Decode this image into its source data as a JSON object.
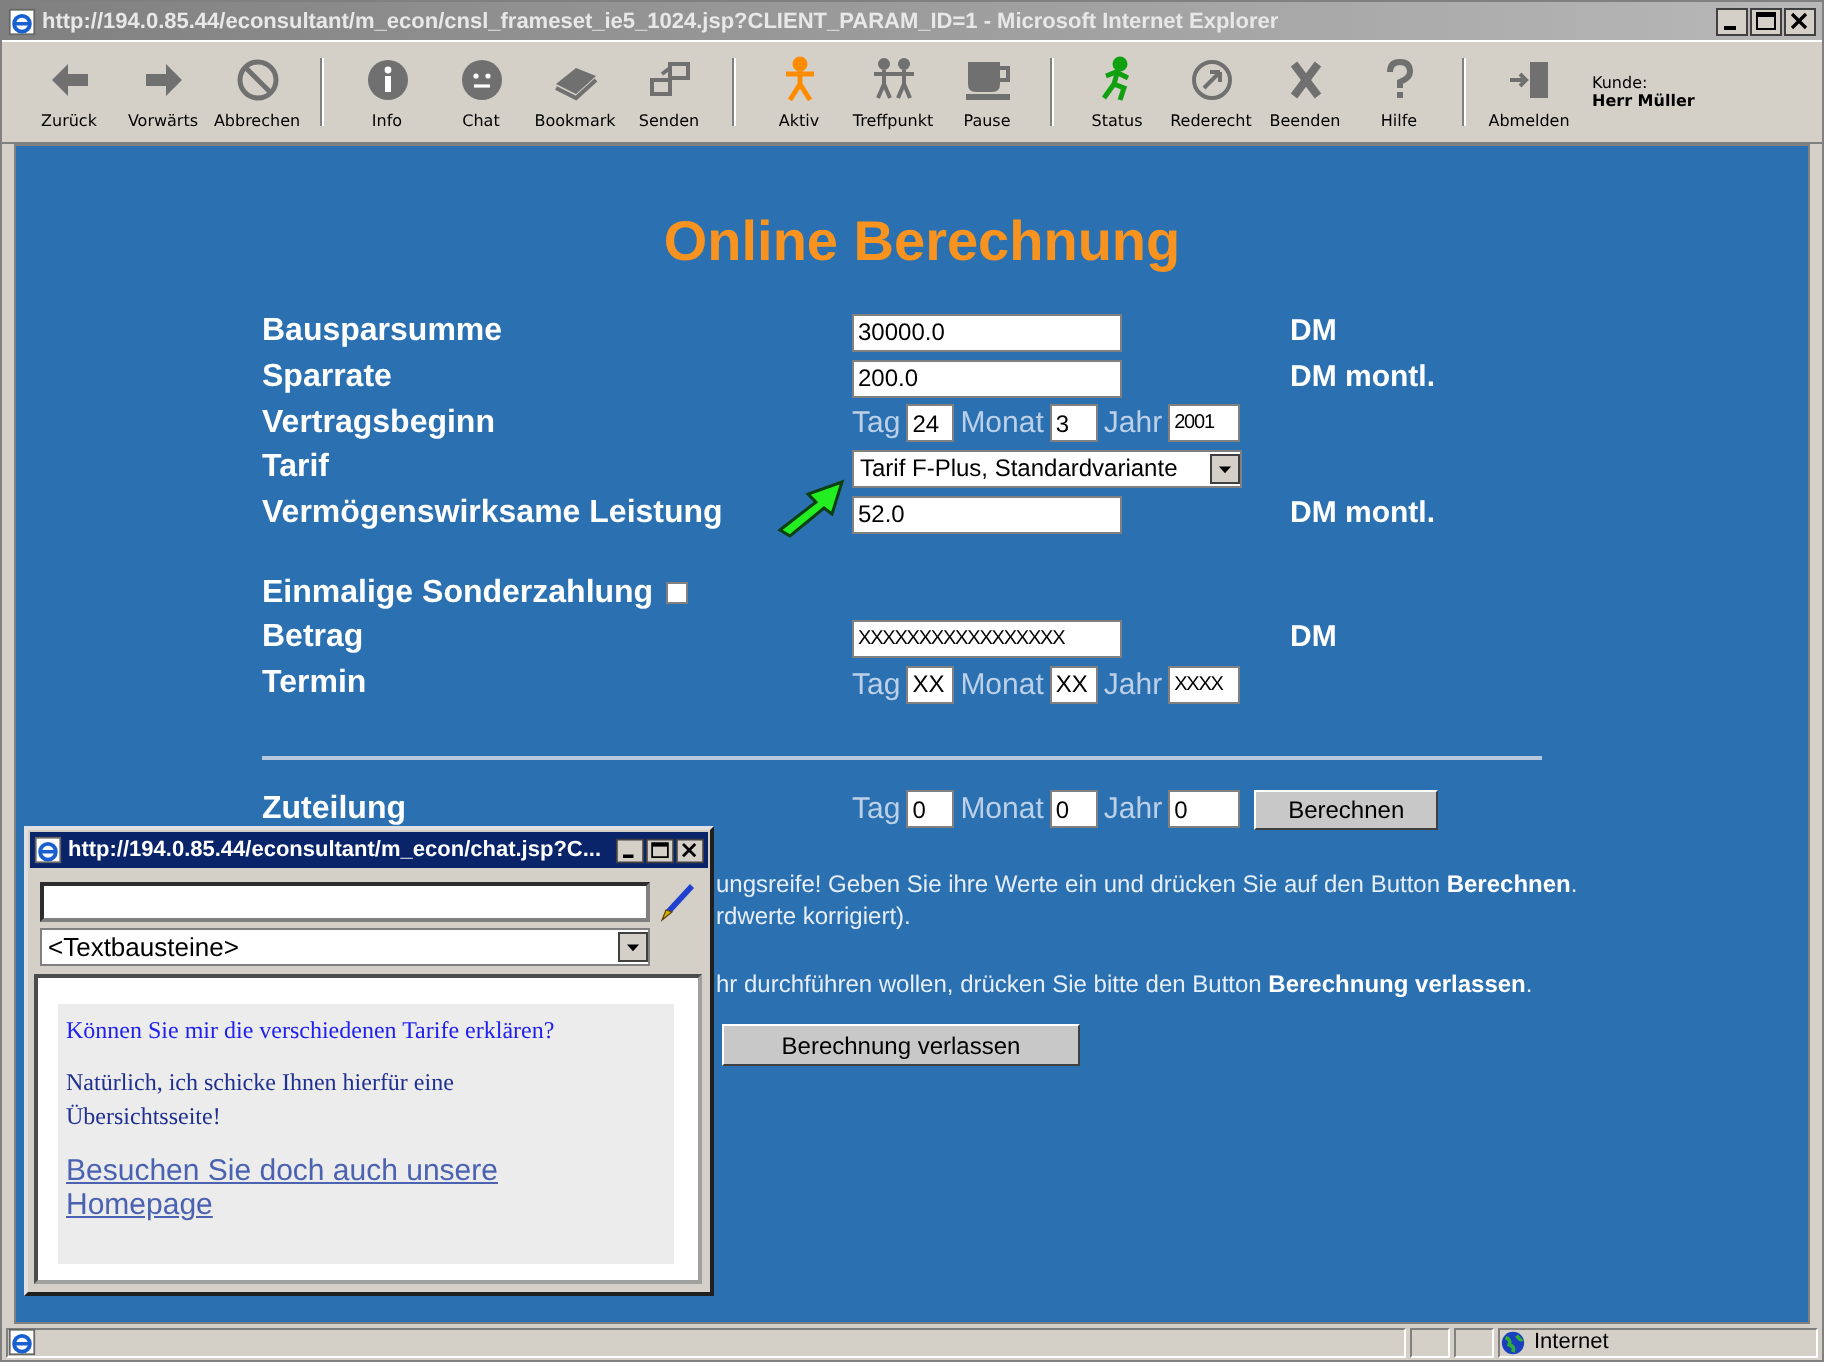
{
  "window": {
    "title": "http://194.0.85.44/econsultant/m_econ/cnsl_frameset_ie5_1024.jsp?CLIENT_PARAM_ID=1 - Microsoft Internet Explorer"
  },
  "toolbar": {
    "groups": [
      [
        {
          "kind": "back",
          "label": "Zurück"
        },
        {
          "kind": "forward",
          "label": "Vorwärts"
        },
        {
          "kind": "stop",
          "label": "Abbrechen"
        }
      ],
      [
        {
          "kind": "info",
          "label": "Info"
        },
        {
          "kind": "chat",
          "label": "Chat"
        },
        {
          "kind": "bookmark",
          "label": "Bookmark"
        },
        {
          "kind": "send",
          "label": "Senden"
        }
      ],
      [
        {
          "kind": "active",
          "label": "Aktiv"
        },
        {
          "kind": "meeting",
          "label": "Treffpunkt"
        },
        {
          "kind": "pause",
          "label": "Pause"
        }
      ],
      [
        {
          "kind": "status",
          "label": "Status"
        },
        {
          "kind": "floor",
          "label": "Rederecht"
        },
        {
          "kind": "end",
          "label": "Beenden"
        },
        {
          "kind": "help",
          "label": "Hilfe"
        }
      ],
      [
        {
          "kind": "logout",
          "label": "Abmelden"
        }
      ]
    ],
    "customer": {
      "label": "Kunde:",
      "name": "Herr Müller"
    }
  },
  "page": {
    "title": "Online Berechnung",
    "groups": [
      {
        "rule": false,
        "rows": [
          {
            "kind": "text",
            "label": "Bausparsumme",
            "value": "30000.0",
            "unit": "DM"
          },
          {
            "kind": "text",
            "label": "Sparrate",
            "value": "200.0",
            "unit": "DM montl."
          },
          {
            "kind": "date",
            "label": "Vertragsbeginn",
            "parts": [
              {
                "label": "Tag",
                "value": "24"
              },
              {
                "label": "Monat",
                "value": "3"
              },
              {
                "label": "Jahr",
                "value": "2001"
              }
            ]
          },
          {
            "kind": "select",
            "label": "Tarif",
            "value": "Tarif F-Plus, Standardvariante"
          },
          {
            "kind": "text",
            "label": "Vermögenswirksame Leistung",
            "value": "52.0",
            "unit": "DM montl."
          }
        ]
      },
      {
        "rule": false,
        "rows": [
          {
            "kind": "checkbox",
            "label": "Einmalige Sonderzahlung",
            "checked": false
          },
          {
            "kind": "text",
            "label": "Betrag",
            "value": "XXXXXXXXXXXXXXXXX",
            "unit": "DM"
          },
          {
            "kind": "date",
            "label": "Termin",
            "parts": [
              {
                "label": "Tag",
                "value": "XX"
              },
              {
                "label": "Monat",
                "value": "XX"
              },
              {
                "label": "Jahr",
                "value": "XXXX"
              }
            ]
          }
        ]
      },
      {
        "rule": true,
        "rows": [
          {
            "kind": "date",
            "label": "Zuteilung",
            "parts": [
              {
                "label": "Tag",
                "value": "0"
              },
              {
                "label": "Monat",
                "value": "0"
              },
              {
                "label": "Jahr",
                "value": "0"
              }
            ],
            "button": "Berechnen"
          }
        ]
      }
    ],
    "notes": [
      [
        "ungsreife! Geben Sie ihre Werte ein und drücken Sie auf den Button **Berechnen**.",
        "rdwerte korrigiert)."
      ],
      [
        "hr durchführen wollen, drücken Sie bitte den Button **Berechnung verlassen**."
      ]
    ],
    "exit_button": "Berechnung verlassen"
  },
  "chat": {
    "title": "http://194.0.85.44/econsultant/m_econ/chat.jsp?C...",
    "snippets": "<Textbausteine>",
    "messages": [
      {
        "kind": "customer",
        "text": "Können Sie mir die verschiedenen Tarife erklären?"
      },
      {
        "kind": "agent",
        "text": "Natürlich, ich schicke Ihnen hierfür eine Übersichtsseite!"
      }
    ],
    "link": "Besuchen Sie doch auch unsere Homepage"
  },
  "status_bar": {
    "zone": "Internet"
  }
}
